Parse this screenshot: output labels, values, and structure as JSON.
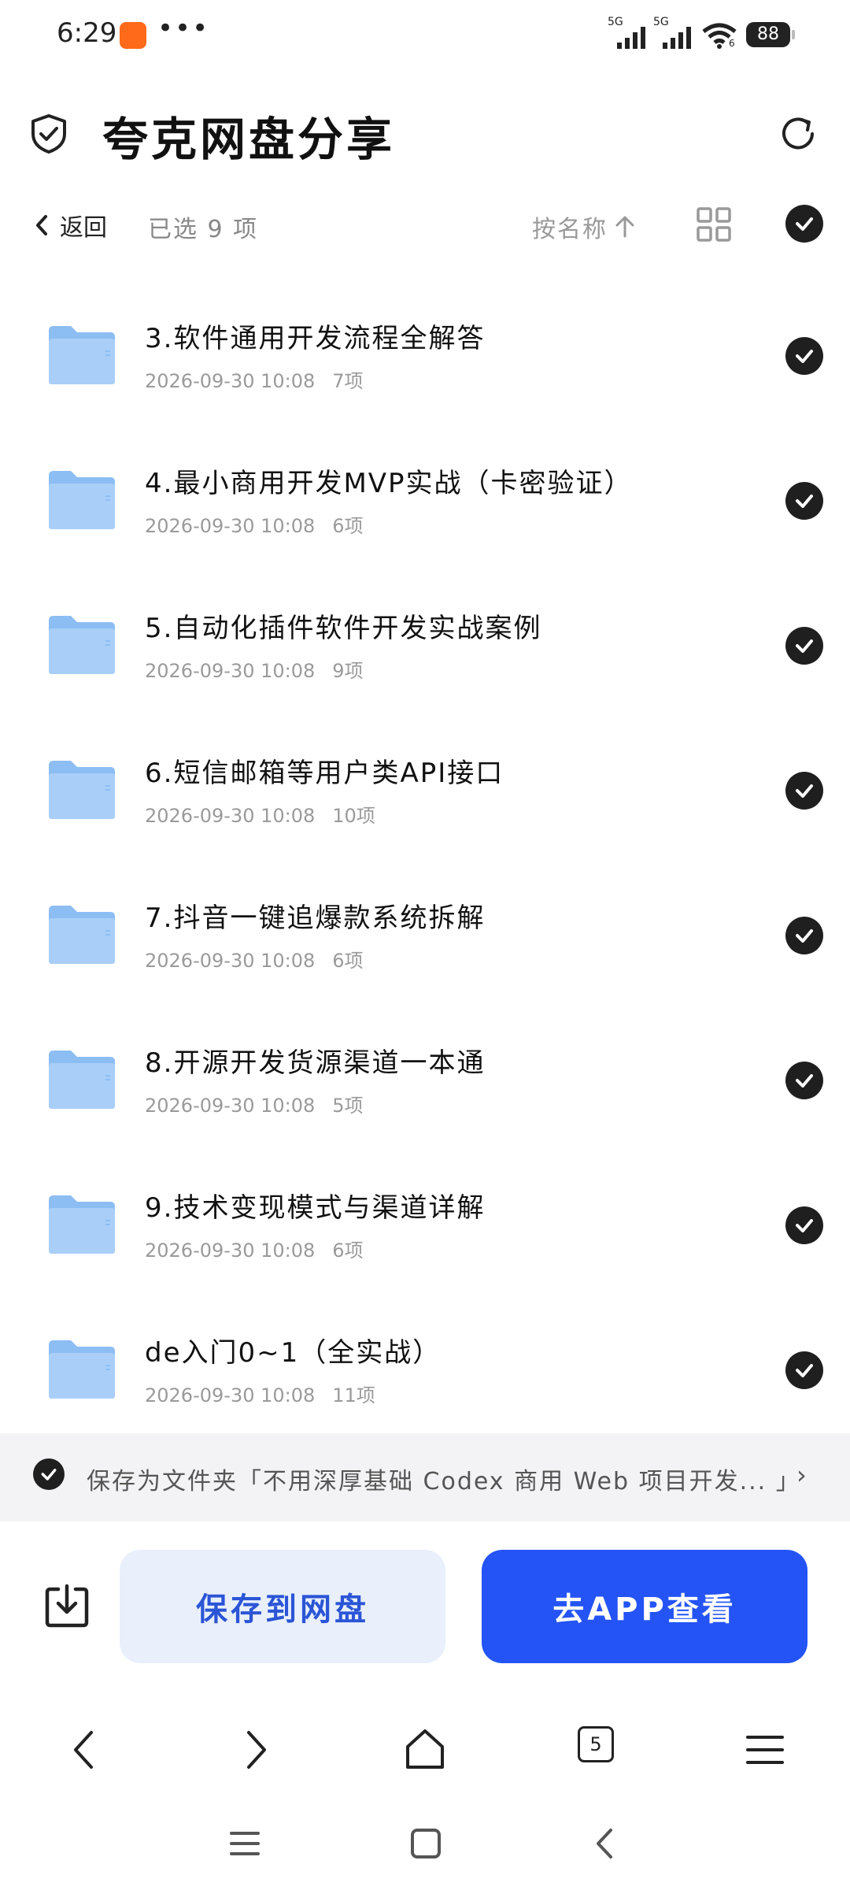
{
  "status": {
    "time": "6:29",
    "more": "•••",
    "signal1": "5G",
    "signal2": "5G",
    "wifi_sub": "6",
    "battery": "88"
  },
  "header": {
    "title": "夸克网盘分享"
  },
  "selection": {
    "back_label": "返回",
    "count_label": "已选 9 项",
    "sort_label": "按名称"
  },
  "files": [
    {
      "name": "3.软件通用开发流程全解答",
      "date": "2026-09-30 10:08",
      "count": "7项"
    },
    {
      "name": "4.最小商用开发MVP实战（卡密验证）",
      "date": "2026-09-30 10:08",
      "count": "6项"
    },
    {
      "name": "5.自动化插件软件开发实战案例",
      "date": "2026-09-30 10:08",
      "count": "9项"
    },
    {
      "name": "6.短信邮箱等用户类API接口",
      "date": "2026-09-30 10:08",
      "count": "10项"
    },
    {
      "name": "7.抖音一键追爆款系统拆解",
      "date": "2026-09-30 10:08",
      "count": "6项"
    },
    {
      "name": "8.开源开发货源渠道一本通",
      "date": "2026-09-30 10:08",
      "count": "5项"
    },
    {
      "name": "9.技术变现模式与渠道详解",
      "date": "2026-09-30 10:08",
      "count": "6项"
    },
    {
      "name": "de入门0~1（全实战）",
      "date": "2026-09-30 10:08",
      "count": "11项"
    }
  ],
  "save_folder": {
    "text": "保存为文件夹「不用深厚基础 Codex 商用 Web 项目开发... 」",
    "arrow": "›"
  },
  "actions": {
    "save_label": "保存到网盘",
    "open_label": "去APP查看"
  },
  "browser": {
    "tab_count": "5"
  },
  "colors": {
    "primary_button": "#2454f5",
    "secondary_button": "#e9f0fc",
    "folder": "#7fb3f0",
    "check": "#1f1f1f"
  },
  "icons": [
    "shield-check-icon",
    "refresh-icon",
    "back-chevron-icon",
    "sort-up-arrow-icon",
    "grid-view-icon",
    "check-circle-icon",
    "folder-icon",
    "download-icon",
    "browser-back-icon",
    "browser-forward-icon",
    "home-icon",
    "tabs-icon",
    "menu-icon"
  ]
}
